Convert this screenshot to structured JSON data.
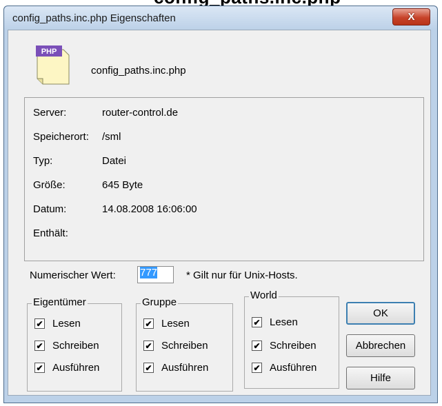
{
  "cut_title": "config_paths.inc.php",
  "window": {
    "title": "config_paths.inc.php Eigenschaften",
    "close_label": "X"
  },
  "file": {
    "icon_text": "PHP",
    "name": "config_paths.inc.php"
  },
  "info": {
    "server_label": "Server:",
    "server_value": "router-control.de",
    "location_label": "Speicherort:",
    "location_value": "/sml",
    "type_label": "Typ:",
    "type_value": "Datei",
    "size_label": "Größe:",
    "size_value": "645  Byte",
    "date_label": "Datum:",
    "date_value": "14.08.2008 16:06:00",
    "contains_label": "Enthält:"
  },
  "numeric": {
    "label": "Numerischer Wert:",
    "value": "777",
    "note": "* Gilt nur für Unix-Hosts."
  },
  "groups": [
    {
      "title": "Eigentümer",
      "read": "Lesen",
      "write": "Schreiben",
      "execute": "Ausführen"
    },
    {
      "title": "Gruppe",
      "read": "Lesen",
      "write": "Schreiben",
      "execute": "Ausführen"
    },
    {
      "title": "World",
      "read": "Lesen",
      "write": "Schreiben",
      "execute": "Ausführen"
    }
  ],
  "checked_mark": "✔",
  "buttons": {
    "ok": "OK",
    "cancel": "Abbrechen",
    "help": "Hilfe"
  }
}
